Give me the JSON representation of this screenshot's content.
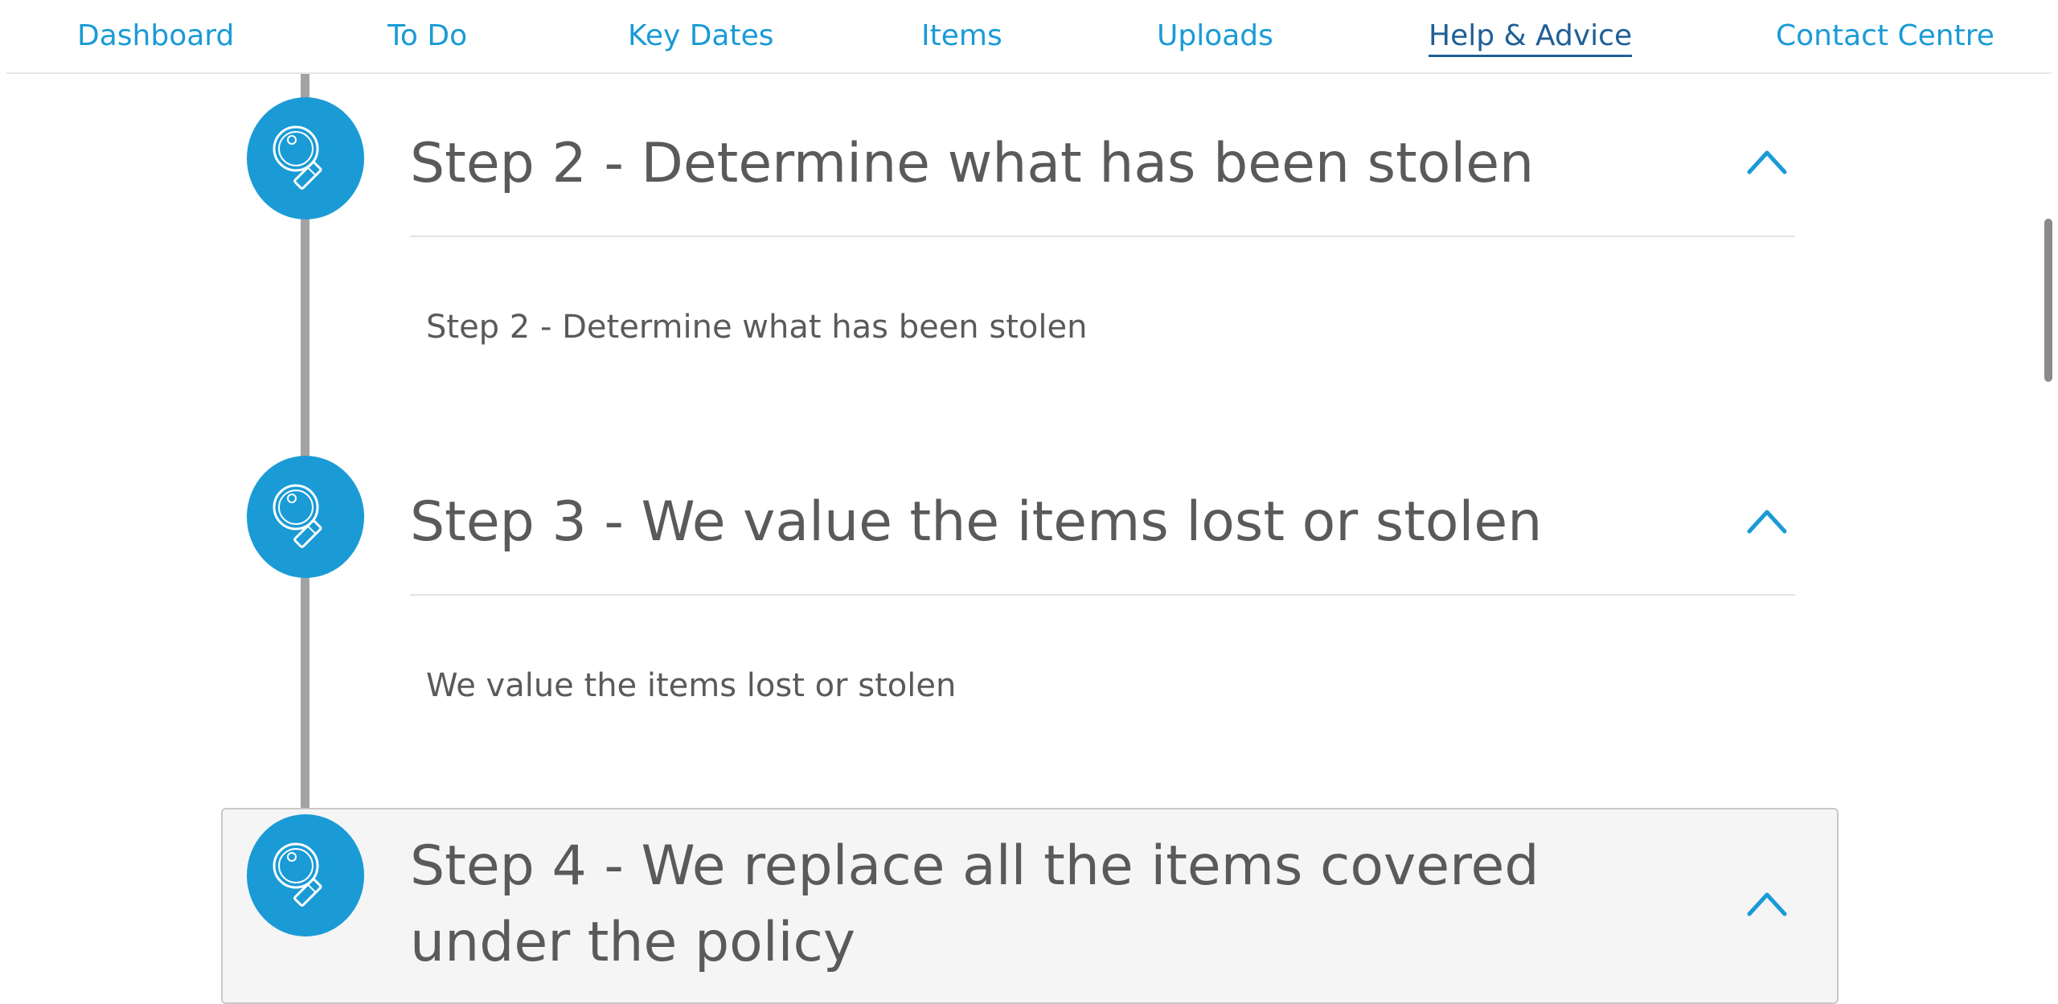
{
  "nav": {
    "items": [
      {
        "label": "Dashboard"
      },
      {
        "label": "To Do"
      },
      {
        "label": "Key Dates"
      },
      {
        "label": "Items"
      },
      {
        "label": "Uploads"
      },
      {
        "label": "Help & Advice",
        "active": true
      },
      {
        "label": "Contact Centre"
      }
    ]
  },
  "steps": [
    {
      "title": "Step 2 - Determine what has been stolen",
      "body": "Step 2 - Determine what has been stolen",
      "icon": "magnifier-icon",
      "expanded": true
    },
    {
      "title": "Step 3 - We value the items lost or stolen",
      "body": "We value the items lost or stolen",
      "icon": "magnifier-icon",
      "expanded": true
    },
    {
      "title": "Step 4 - We replace all the items covered under the policy",
      "icon": "magnifier-icon",
      "expanded": true,
      "highlighted": true
    }
  ],
  "colors": {
    "accent": "#1a9bd6",
    "active_nav": "#1f5f96",
    "text": "#5a5a5a",
    "timeline": "#a3a3a3"
  }
}
